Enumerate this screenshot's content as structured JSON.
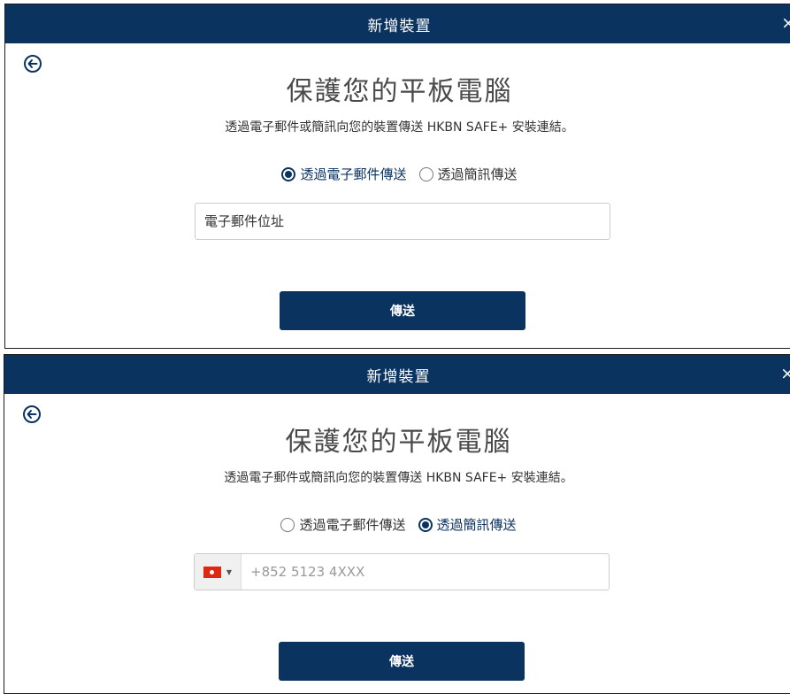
{
  "dialog_title": "新增裝置",
  "close_glyph": "×",
  "heading": "保護您的平板電腦",
  "subtitle": "透過電子郵件或簡訊向您的裝置傳送 HKBN SAFE+ 安裝連結。",
  "radio_email_label": "透過電子郵件傳送",
  "radio_sms_label": "透過簡訊傳送",
  "email_placeholder": "電子郵件位址",
  "phone_placeholder": "+852 5123 4XXX",
  "phone_flag": "hong-kong-flag",
  "send_label": "傳送",
  "panels": [
    {
      "selected": "email"
    },
    {
      "selected": "sms"
    }
  ],
  "colors": {
    "primary": "#0b3360",
    "text": "#333333"
  }
}
